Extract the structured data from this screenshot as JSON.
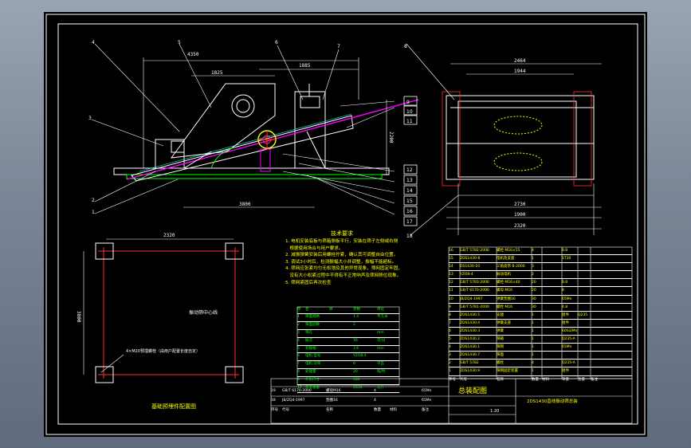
{
  "drawing": {
    "part_callouts_left": [
      "4",
      "3",
      "2",
      "1"
    ],
    "part_callouts_top": [
      "5",
      "6",
      "7",
      "8"
    ],
    "part_callouts_right": [
      "9",
      "10",
      "11",
      "12",
      "13",
      "14",
      "15",
      "16",
      "17",
      "18"
    ],
    "dims_side": {
      "top": "4350",
      "second": "1825",
      "third": "1885",
      "bottom_overall": "3800",
      "height": "2200"
    },
    "dims_end": {
      "top": "2464",
      "second": "1944",
      "bottom1": "2730",
      "bottom2": "1900",
      "bottom3": "2320"
    },
    "dims_foundation": {
      "width": "2320",
      "height": "3800"
    }
  },
  "texts": {
    "foundation_label": "振动筛中心线",
    "anchor_note": "4×M20预埋螺栓（由用户配置长度自定）",
    "foundation_title": "基础预埋件配置图",
    "tech_title": "技术要求",
    "tech_lines": [
      "1. 电机安装底板与筛箱侧板平行，安装在筛子左侧或右侧",
      "   根据使用场合与用户要求。",
      "2. 减振弹簧安装后用螺栓拧紧，确认其可调整自由位置。",
      "3. 调试3小时后，检测振幅大小并调整，振幅不能超标。",
      "4. 筛网应张紧均匀无松弛及其他异常现象，筛网固定牢固，",
      "   没有大小松紧过程中不得有不正常响声及筛网移位现象。",
      "5. 筛网紧固后再次检查"
    ],
    "main_title": "总装配图",
    "drawing_name": "2DS1430直线振动筛总装",
    "scale": "1:20"
  },
  "params": {
    "headers": [
      "序",
      "名",
      "称",
      "参数",
      "单位"
    ],
    "rows": [
      [
        "1",
        "筛面规格",
        "",
        "1.4",
        "平方米"
      ],
      [
        "2",
        "筛面层数",
        "",
        "2",
        ""
      ],
      [
        "3",
        "筛孔",
        "",
        "",
        "mm"
      ],
      [
        "4",
        "振次",
        "",
        "16",
        "次/分"
      ],
      [
        "5",
        "双振幅",
        "",
        "3.6",
        "mm"
      ],
      [
        "6",
        "电机 型号",
        "",
        "YZO8-4",
        ""
      ],
      [
        "7",
        "电机 功率",
        "",
        "6",
        "千瓦"
      ],
      [
        "8",
        "处理量",
        "",
        "20",
        "吨/时"
      ],
      [
        "9",
        "外形尺寸",
        "",
        "580",
        ""
      ],
      [
        "10",
        "参考重量",
        "",
        "2834",
        "公斤"
      ]
    ]
  },
  "parts": {
    "rows": [
      [
        "16",
        "GB/T 5782-2000",
        "螺栓 M16×55",
        "4",
        "",
        "8.8",
        ""
      ],
      [
        "15",
        "ZDS1430-8",
        "电机及支座",
        "1",
        "",
        "ST30",
        ""
      ],
      [
        "14",
        "DS1430-10",
        "三角皮带 B-2000",
        "3",
        "",
        "",
        ""
      ],
      [
        "13",
        "YZO8-4",
        "振动电机",
        "2",
        "",
        "",
        ""
      ],
      [
        "12",
        "GB/T 5783-2000",
        "螺栓 M16×40",
        "20",
        "",
        "8.8",
        ""
      ],
      [
        "11",
        "GB/T 6170-2000",
        "螺母 M16",
        "20",
        "",
        "8",
        ""
      ],
      [
        "10",
        "JB/ZQ4-1997",
        "弹簧垫圈16",
        "30",
        "",
        "65Mn",
        ""
      ],
      [
        "9",
        "GB/T 5781-2000",
        "螺栓 M16",
        "30",
        "",
        "4.8",
        ""
      ],
      [
        "8",
        "ZDS1430.5",
        "支腿",
        "1",
        "",
        "组件",
        "Q235"
      ],
      [
        "7",
        "ZDS1430.4",
        "弹簧支座",
        "1",
        "",
        "组件",
        ""
      ],
      [
        "6",
        "ZDS1430.3",
        "弹簧",
        "1",
        "",
        "60Si2Mn",
        ""
      ],
      [
        "5",
        "ZDS1430.2",
        "筛箱",
        "1",
        "",
        "Q235-A",
        ""
      ],
      [
        "4",
        "ZDS1430.1",
        "筛网",
        "1",
        "",
        "65Mn",
        ""
      ],
      [
        "3",
        "ZDS1430.7",
        "筛面",
        "1",
        "",
        "",
        ""
      ],
      [
        "2",
        "GB/T 5782",
        "螺栓",
        "4",
        "",
        "Q235-A",
        ""
      ],
      [
        "1",
        "ZDS1430.9",
        "筛网固定装置",
        "1",
        "",
        "组件",
        ""
      ]
    ],
    "headers": [
      "序号",
      "代号",
      "名称",
      "数量",
      "材料",
      "单重",
      "总重",
      "备注"
    ]
  },
  "small_bom": {
    "rows": [
      [
        "19",
        "GB/T 6170-2000",
        "螺母M16",
        "4",
        "",
        "65Mn"
      ],
      [
        "18",
        "JB/ZQ4-1997",
        "垫圈16",
        "4",
        "",
        "65Mn"
      ]
    ],
    "headers": [
      "序号",
      "代号",
      "名称",
      "数量",
      "材料",
      "备注"
    ]
  },
  "colors": {
    "line": "#ffffff",
    "yellow": "#ffff00",
    "green": "#00ff00",
    "magenta": "#ff00ff",
    "red": "#ff3030",
    "cyan": "#00ffff"
  }
}
